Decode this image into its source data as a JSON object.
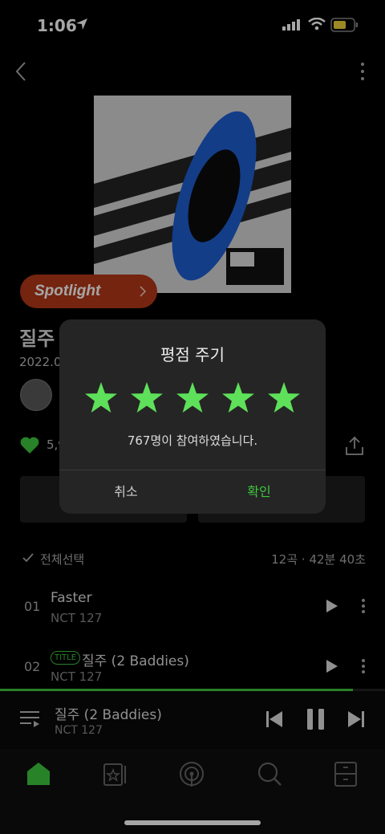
{
  "status_bar": {
    "time": "1:06"
  },
  "album": {
    "spotlight_label": "Spotlight",
    "title": "질주",
    "date": "2022.0",
    "like_count": "5,9"
  },
  "tracklist": {
    "select_all": "전체선택",
    "summary": "12곡 · 42분 40초",
    "tracks": [
      {
        "num": "01",
        "title": "Faster",
        "artist": "NCT 127",
        "badge": ""
      },
      {
        "num": "02",
        "title": "질주 (2 Baddies)",
        "artist": "NCT 127",
        "badge": "TITLE"
      }
    ]
  },
  "now_playing": {
    "title": "질주 (2 Baddies)",
    "artist": "NCT 127",
    "progress": 0.917
  },
  "rating_dialog": {
    "title": "평점 주기",
    "stars": 5,
    "participants": "767명이 참여하였습니다.",
    "cancel": "취소",
    "confirm": "확인"
  },
  "colors": {
    "accent": "#3ec83e",
    "star": "#5ee05a",
    "spotlight": "#b23818"
  },
  "icons": [
    "back-icon",
    "more-icon",
    "heart-icon",
    "share-icon",
    "check-icon",
    "play-icon",
    "list-icon",
    "prev-icon",
    "pause-icon",
    "next-icon",
    "home-icon",
    "library-icon",
    "podcast-icon",
    "search-icon",
    "storage-icon"
  ]
}
